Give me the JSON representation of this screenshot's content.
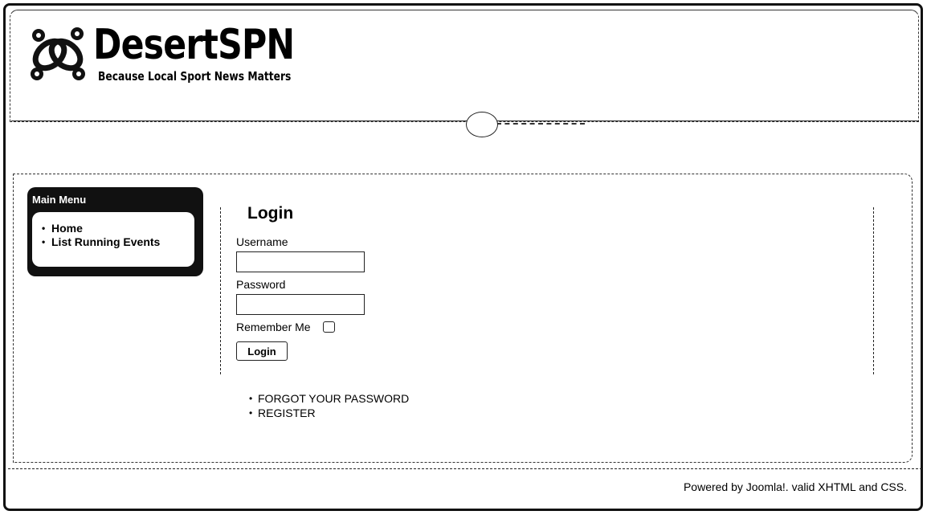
{
  "site": {
    "title": "DesertSPN",
    "tagline": "Because Local Sport News Matters",
    "logo_icon": "chain-links-logo-icon"
  },
  "sidebar": {
    "title": "Main Menu",
    "items": [
      {
        "label": "Home"
      },
      {
        "label": "List Running Events"
      }
    ]
  },
  "login": {
    "heading": "Login",
    "username_label": "Username",
    "username_value": "",
    "password_label": "Password",
    "password_value": "",
    "remember_label": "Remember Me",
    "remember_checked": false,
    "submit_label": "Login",
    "links": [
      {
        "label": "FORGOT YOUR PASSWORD"
      },
      {
        "label": "REGISTER"
      }
    ]
  },
  "footer": {
    "text": "Powered by Joomla!. valid XHTML and CSS."
  }
}
